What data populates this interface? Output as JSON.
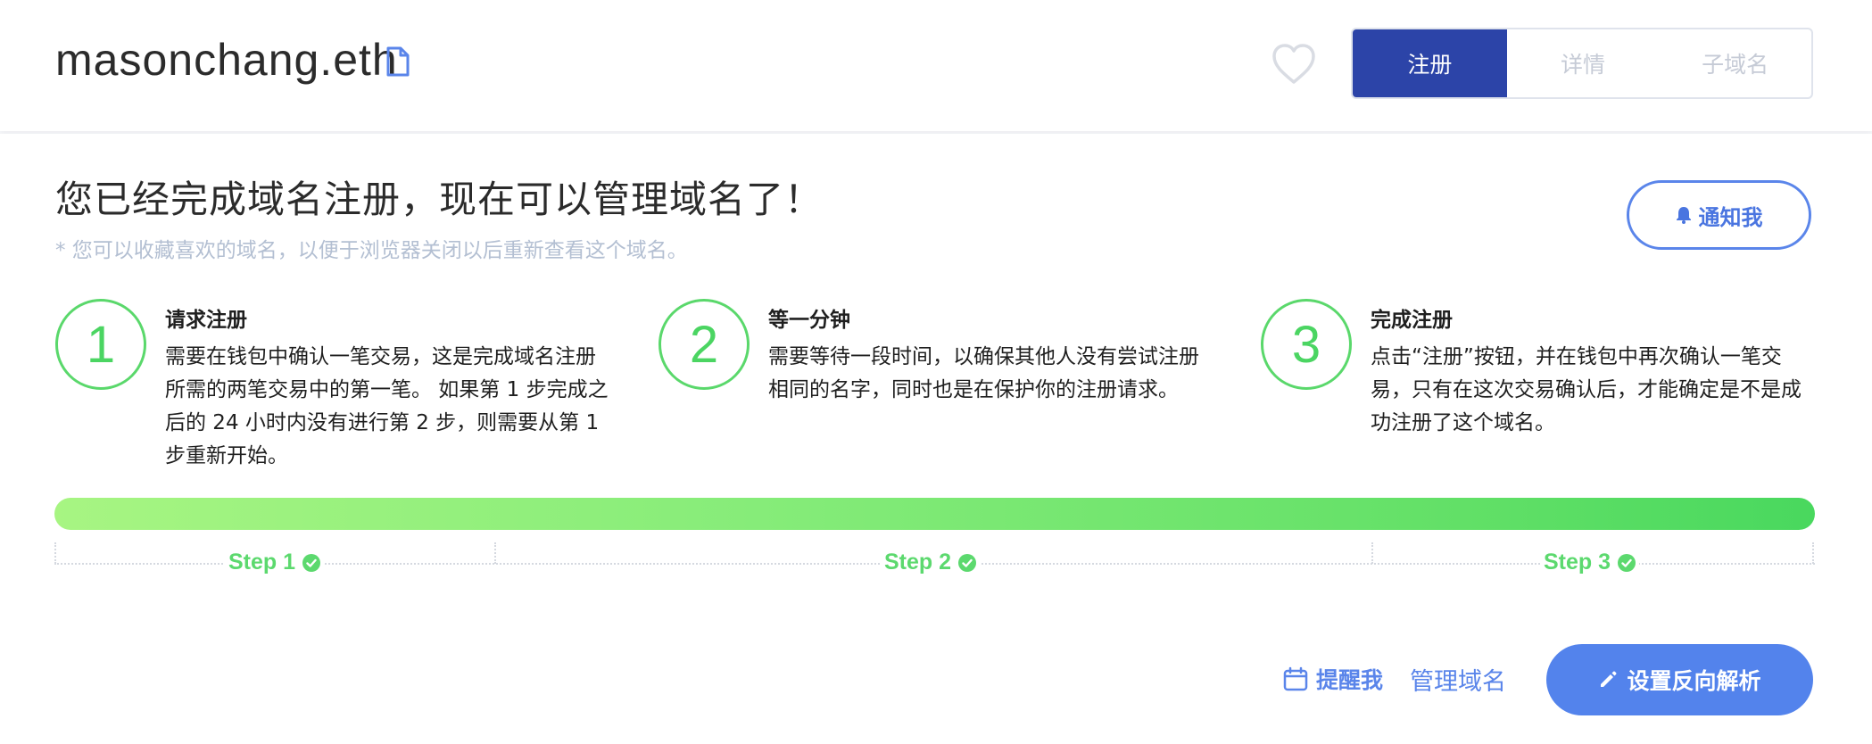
{
  "header": {
    "domain": "masonchang.eth",
    "tabs": [
      {
        "label": "注册",
        "active": true
      },
      {
        "label": "详情",
        "active": false
      },
      {
        "label": "子域名",
        "active": false
      }
    ]
  },
  "main": {
    "headline": "您已经完成域名注册，现在可以管理域名了！",
    "subnote": "* 您可以收藏喜欢的域名，以便于浏览器关闭以后重新查看这个域名。",
    "notify_label": "通知我",
    "steps": [
      {
        "number": "1",
        "title": "请求注册",
        "desc": "需要在钱包中确认一笔交易，这是完成域名注册所需的两笔交易中的第一笔。 如果第 1 步完成之后的 24 小时内没有进行第 2 步，则需要从第 1 步重新开始。"
      },
      {
        "number": "2",
        "title": "等一分钟",
        "desc": "需要等待一段时间，以确保其他人没有尝试注册相同的名字，同时也是在保护你的注册请求。"
      },
      {
        "number": "3",
        "title": "完成注册",
        "desc": "点击“注册”按钮，并在钱包中再次确认一笔交易，只有在这次交易确认后，才能确定是不是成功注册了这个域名。"
      }
    ],
    "progress_fraction": 1.0,
    "step_labels": [
      "Step 1",
      "Step 2",
      "Step 3"
    ],
    "actions": {
      "remind_label": "提醒我",
      "manage_label": "管理域名",
      "reverse_label": "设置反向解析"
    }
  },
  "colors": {
    "tab_active": "#2c44a8",
    "accent_blue": "#5383ec",
    "step_green": "#4bd562",
    "progress_start": "#a7f582",
    "progress_end": "#49d85e"
  },
  "icons": [
    "doc-icon",
    "heart-icon",
    "bell-icon",
    "check-icon",
    "calendar-icon",
    "pencil-icon"
  ]
}
